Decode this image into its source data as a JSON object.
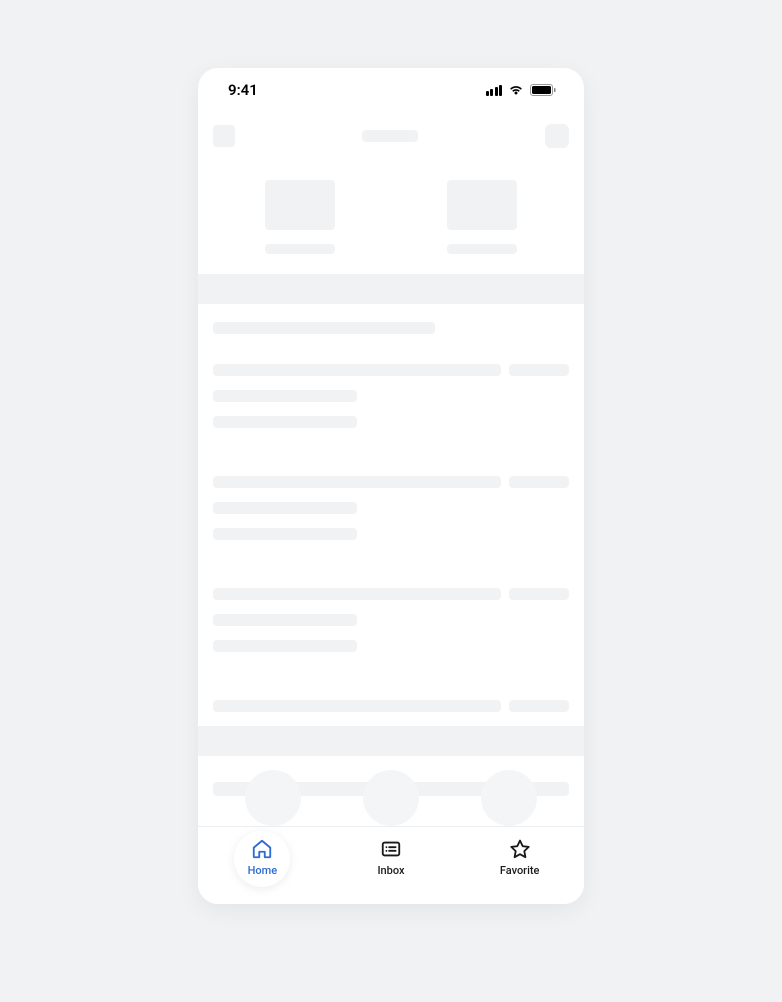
{
  "status_bar": {
    "time": "9:41"
  },
  "nav": {
    "items": [
      {
        "label": "Home"
      },
      {
        "label": "Inbox"
      },
      {
        "label": "Favorite"
      }
    ]
  }
}
